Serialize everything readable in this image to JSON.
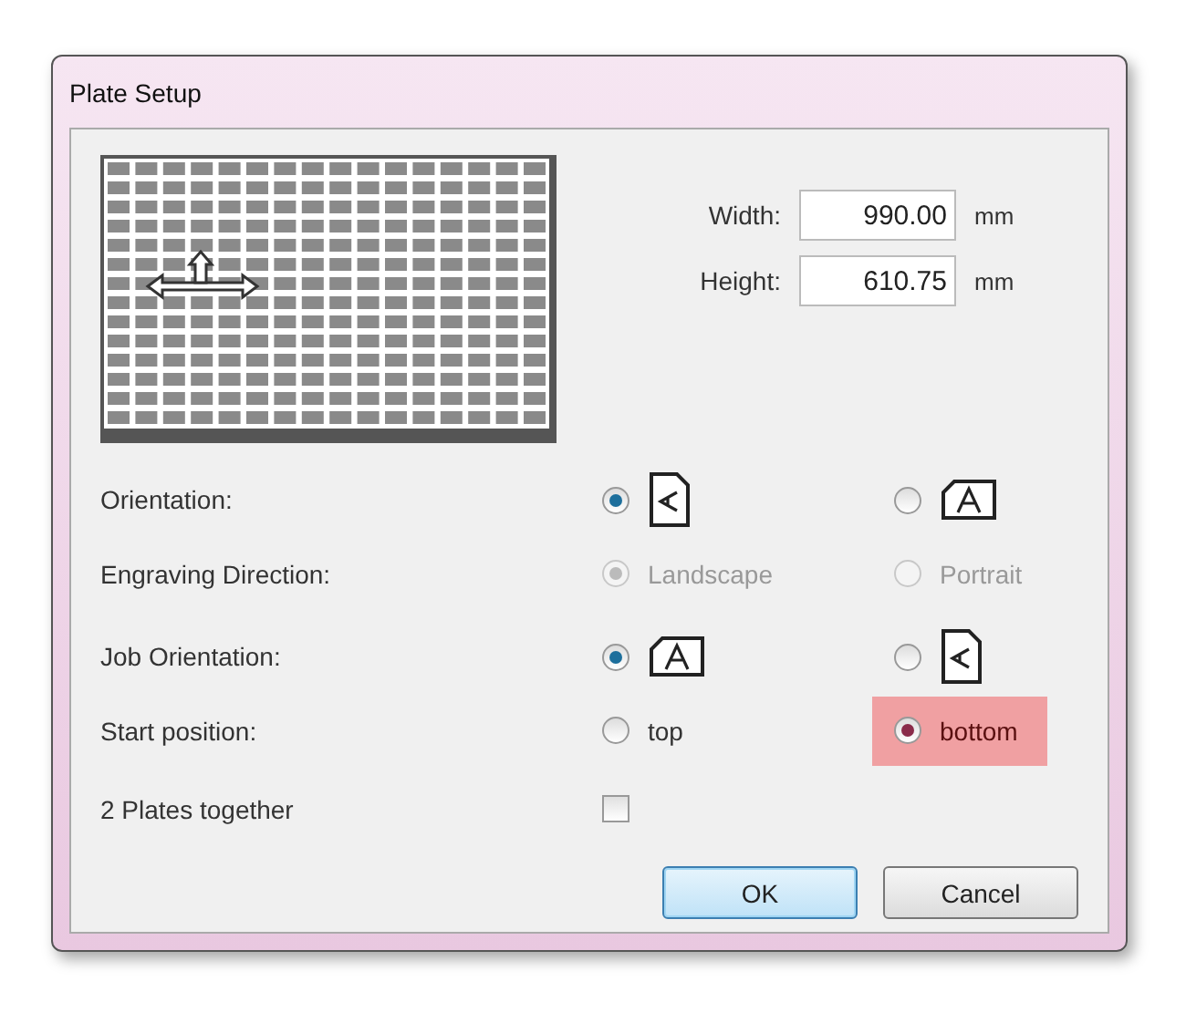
{
  "window": {
    "title": "Plate Setup"
  },
  "size_fields": [
    {
      "label": "Width:",
      "value": "990.00",
      "unit": "mm"
    },
    {
      "label": "Height:",
      "value": "610.75",
      "unit": "mm"
    }
  ],
  "rows": [
    {
      "label": "Orientation:",
      "kind": "radio",
      "options": [
        {
          "kind": "portrait",
          "selected": true,
          "highlighted": false
        },
        {
          "kind": "landscape",
          "selected": false,
          "highlighted": false
        }
      ]
    },
    {
      "label": "Engraving Direction:",
      "kind": "radio",
      "disabled": true,
      "options": [
        {
          "kind": "text",
          "text": "Landscape",
          "selected": true,
          "highlighted": false
        },
        {
          "kind": "text",
          "text": "Portrait",
          "selected": false,
          "highlighted": false
        }
      ]
    },
    {
      "label": "Job Orientation:",
      "kind": "radio",
      "options": [
        {
          "kind": "landscape",
          "selected": true,
          "highlighted": false
        },
        {
          "kind": "portrait",
          "selected": false,
          "highlighted": false
        }
      ]
    },
    {
      "label": "Start position:",
      "kind": "radio",
      "options": [
        {
          "kind": "text",
          "text": "top",
          "selected": false,
          "highlighted": false
        },
        {
          "kind": "text",
          "text": "bottom",
          "selected": true,
          "highlighted": true
        }
      ]
    },
    {
      "label": "2 Plates together",
      "kind": "checkbox",
      "checked": false
    }
  ],
  "buttons": [
    {
      "label": "OK",
      "default": true
    },
    {
      "label": "Cancel",
      "default": false
    }
  ]
}
